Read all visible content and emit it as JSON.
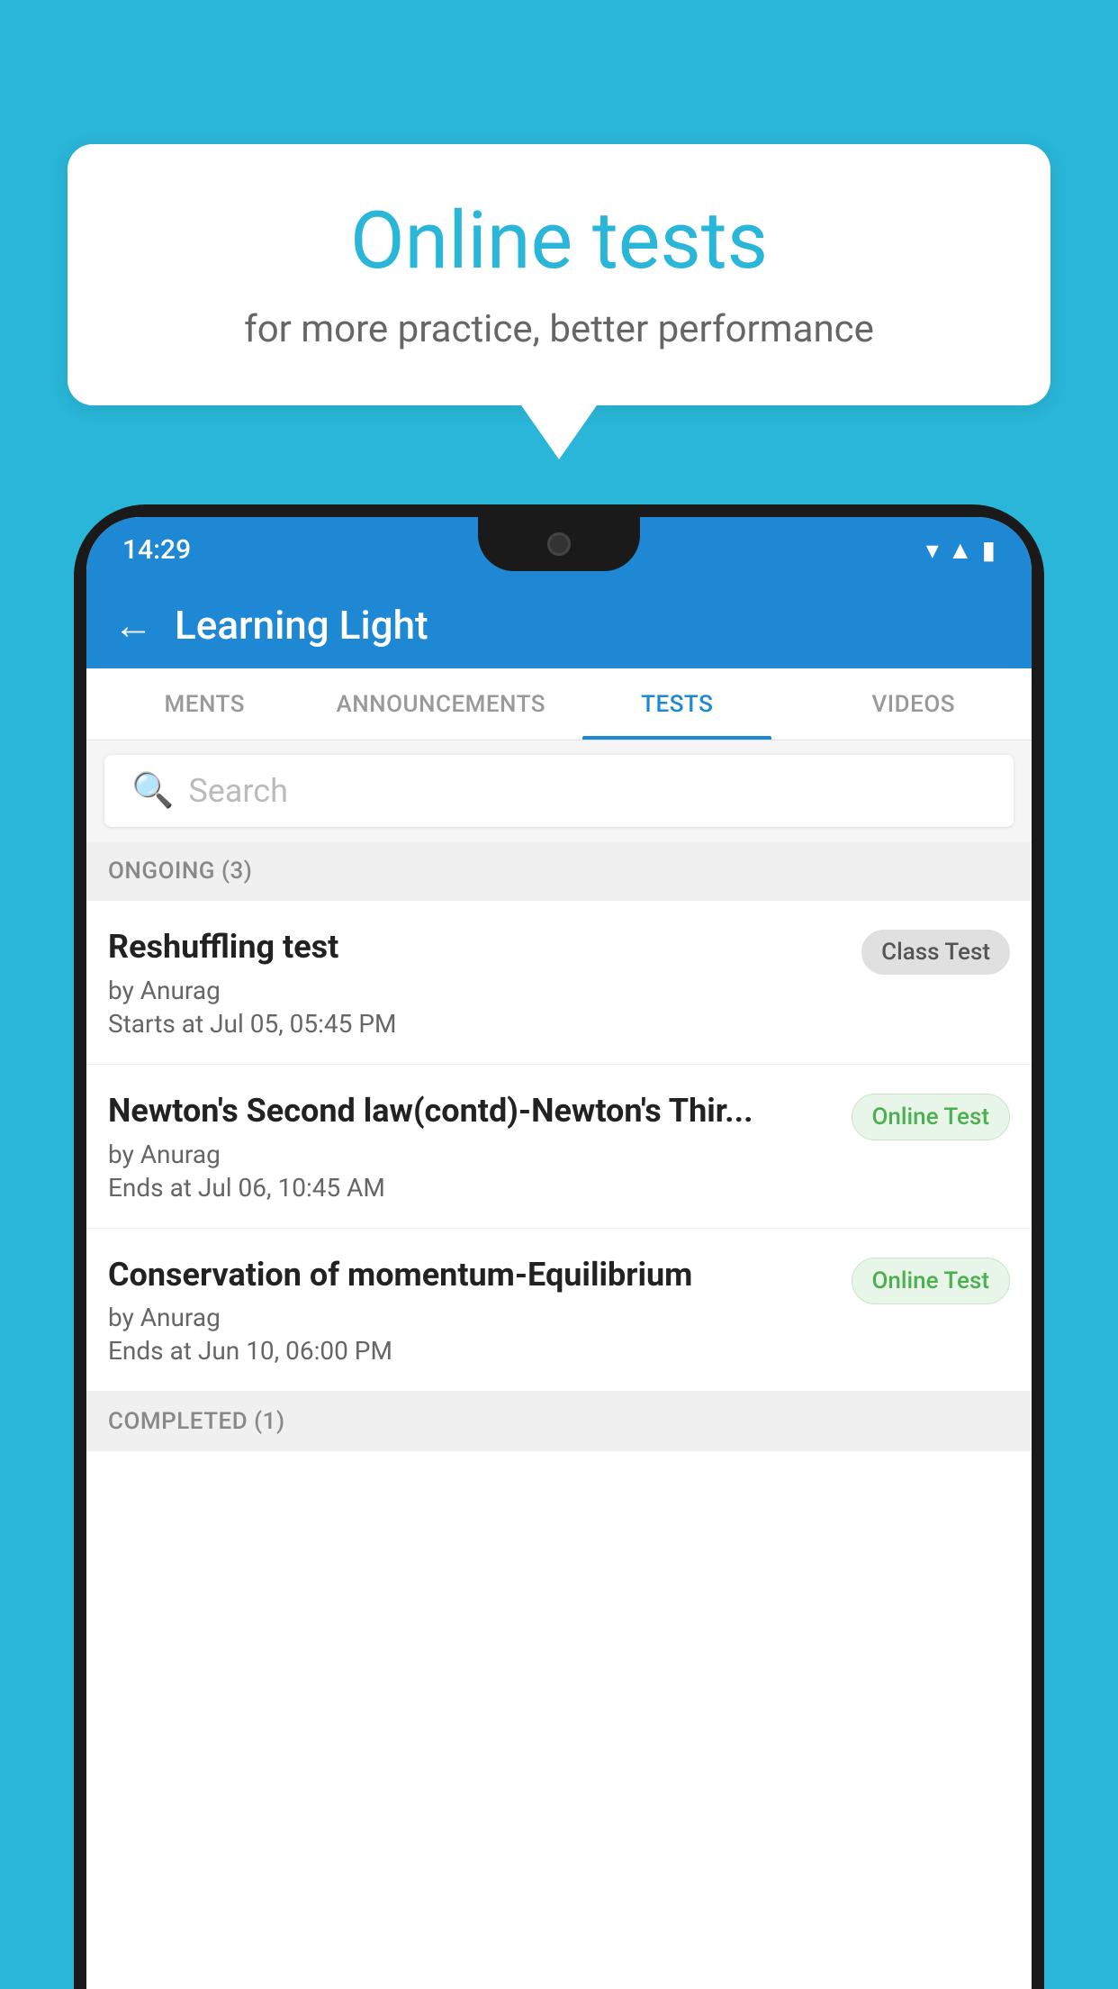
{
  "background": {
    "color": "#29b6d8"
  },
  "speech_bubble": {
    "title": "Online tests",
    "subtitle": "for more practice, better performance"
  },
  "phone": {
    "status_bar": {
      "time": "14:29",
      "icons": [
        "wifi",
        "signal",
        "battery"
      ]
    },
    "app_header": {
      "title": "Learning Light",
      "back_label": "←"
    },
    "tabs": [
      {
        "label": "MENTS",
        "active": false
      },
      {
        "label": "ANNOUNCEMENTS",
        "active": false
      },
      {
        "label": "TESTS",
        "active": true
      },
      {
        "label": "VIDEOS",
        "active": false
      }
    ],
    "search": {
      "placeholder": "Search"
    },
    "sections": [
      {
        "label": "ONGOING (3)",
        "items": [
          {
            "name": "Reshuffling test",
            "by": "by Anurag",
            "time": "Starts at  Jul 05, 05:45 PM",
            "badge": "Class Test",
            "badge_type": "class"
          },
          {
            "name": "Newton's Second law(contd)-Newton's Thir...",
            "by": "by Anurag",
            "time": "Ends at  Jul 06, 10:45 AM",
            "badge": "Online Test",
            "badge_type": "online"
          },
          {
            "name": "Conservation of momentum-Equilibrium",
            "by": "by Anurag",
            "time": "Ends at  Jun 10, 06:00 PM",
            "badge": "Online Test",
            "badge_type": "online"
          }
        ]
      },
      {
        "label": "COMPLETED (1)",
        "items": []
      }
    ]
  }
}
